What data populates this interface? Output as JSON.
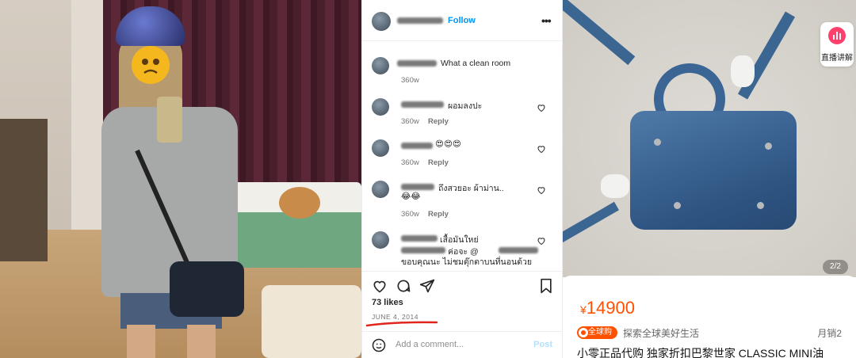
{
  "instagram": {
    "header": {
      "follow_label": "Follow",
      "more_icon": "more-dots-icon"
    },
    "comments": [
      {
        "text": "What a clean room",
        "time": "360w",
        "reply": ""
      },
      {
        "text": "ผอมลงปะ",
        "time": "360w",
        "reply": "Reply"
      },
      {
        "text": "😍😍😍",
        "time": "360w",
        "reply": "Reply"
      },
      {
        "text": "ถึงสวยอะ ผ้าม่าน..",
        "time": "360w",
        "reply": "Reply"
      },
      {
        "text": "😂😂",
        "time": "360w",
        "reply": "Reply"
      },
      {
        "text": "เสื้อมันใหย่",
        "text2": "ค่อจะ @",
        "text3": "ขอบคุณนะ ไม่ชมตุ๊กตาบนที่นอนด้วย"
      }
    ],
    "likes": "73 likes",
    "date": "JUNE 4, 2014",
    "add_comment_placeholder": "Add a comment...",
    "post_label": "Post",
    "colors": {
      "follow": "#0095f6",
      "underline": "#e0261c"
    }
  },
  "product": {
    "live_label": "直播讲解",
    "image_counter": "2/2",
    "price_symbol": "¥",
    "price_value": "14900",
    "badge_label": "全球购",
    "store_name": "探索全球美好生活",
    "sales": "月销2",
    "title": "小零正品代购 独家折扣巴黎世家 CLASSIC MINI油",
    "colors": {
      "price": "#ff5000",
      "badge": "#ff5000",
      "live_icon": "#ff3f6c"
    }
  }
}
